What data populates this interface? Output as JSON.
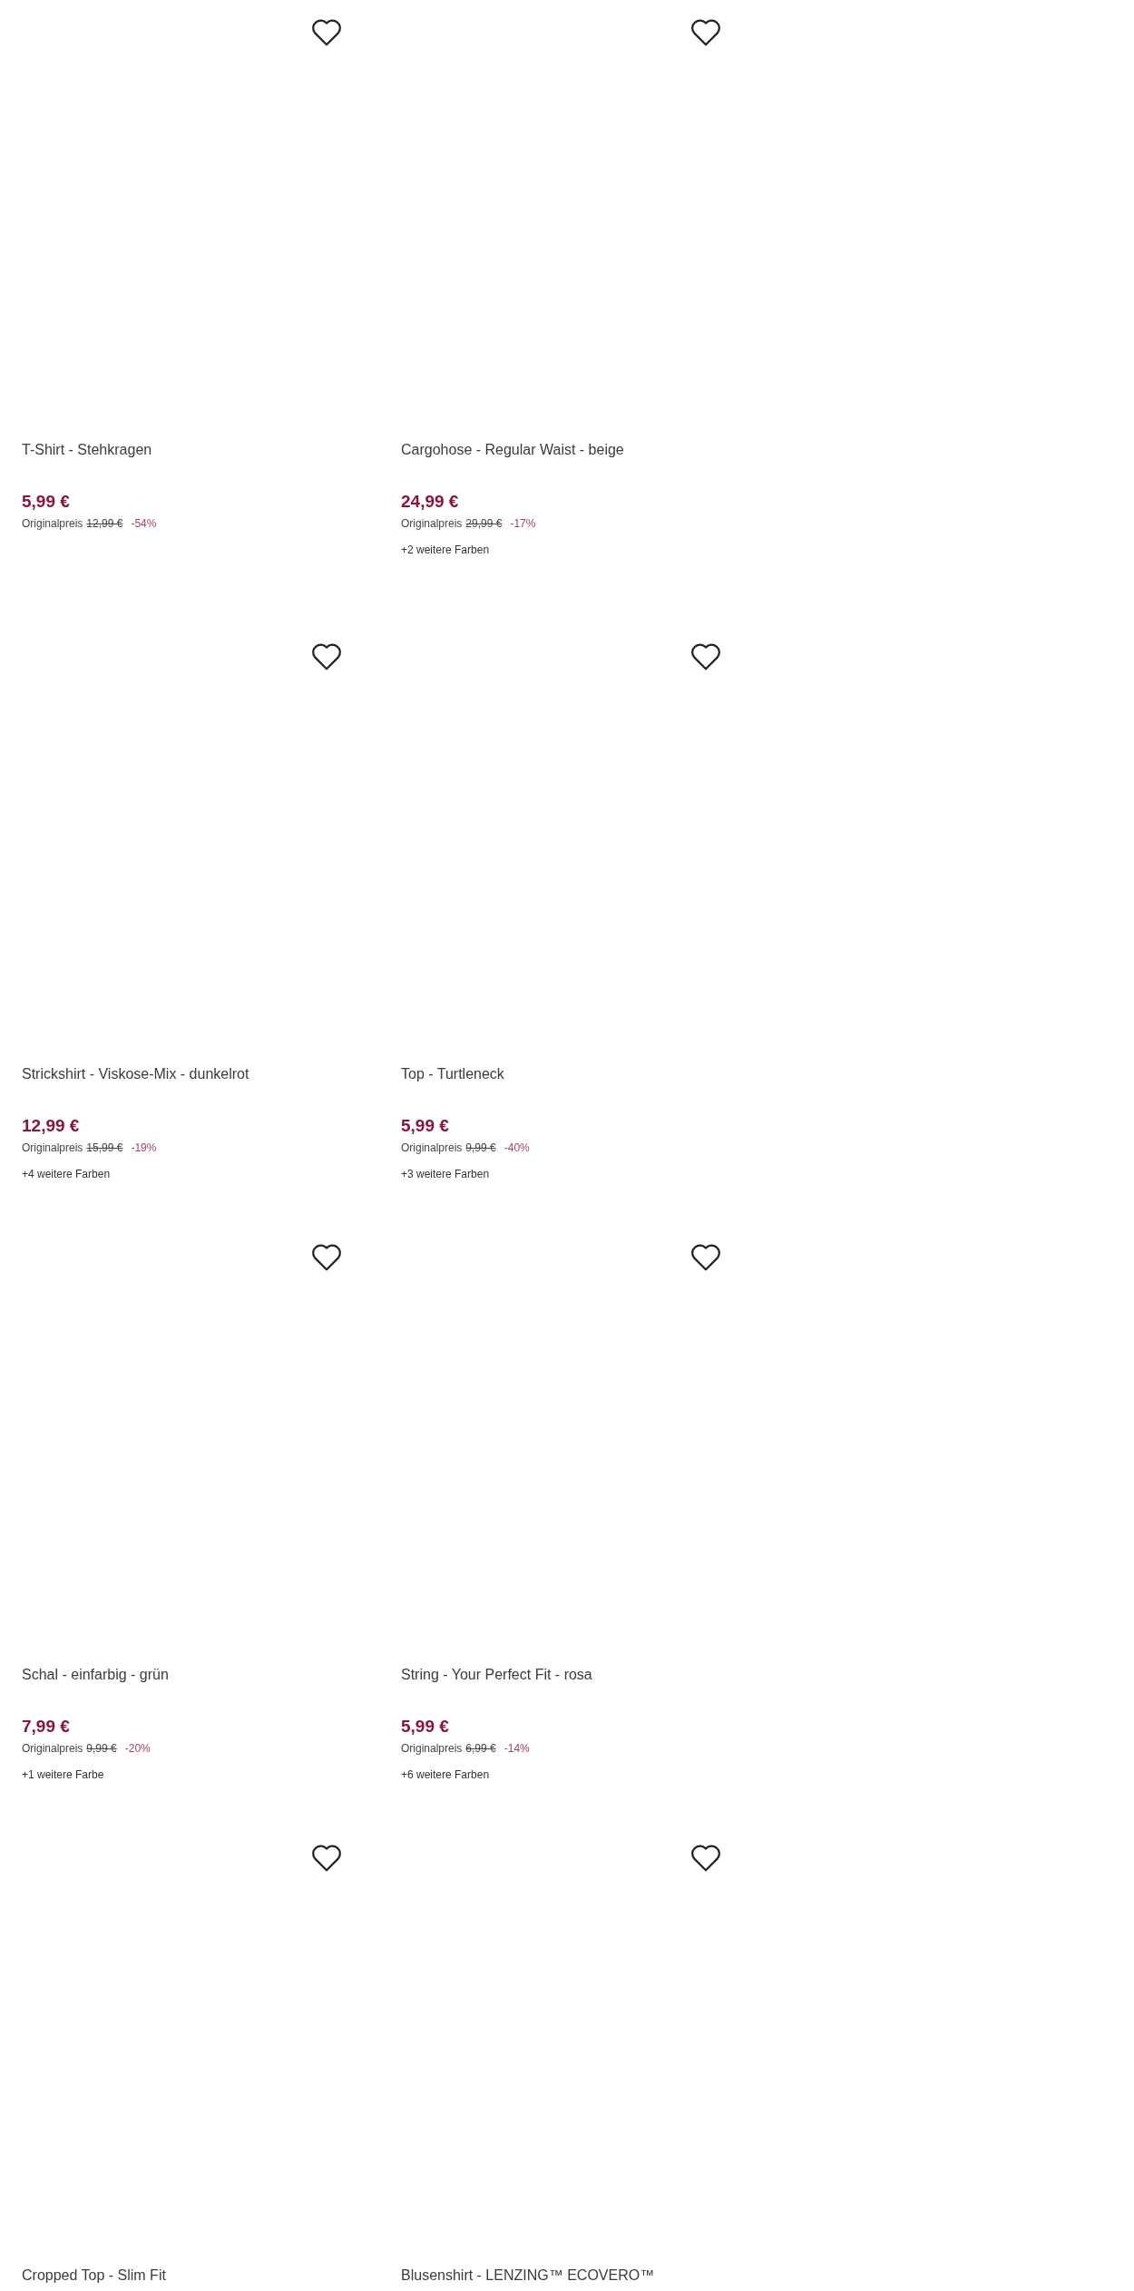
{
  "products": [
    {
      "title": "T-Shirt - Stehkragen",
      "price": "5,99 €",
      "original_label": "Originalpreis",
      "original_price": "12,99 €",
      "discount": "-54%",
      "favorite": false
    },
    {
      "title": "Cargohose - Regular Waist - beige",
      "price": "24,99 €",
      "original_label": "Originalpreis",
      "original_price": "29,99 €",
      "discount": "-17%",
      "more_colors": "+2 weitere Farben",
      "favorite": false
    },
    {
      "title": "Strickshirt - Viskose-Mix - dunkelrot",
      "price": "12,99 €",
      "original_label": "Originalpreis",
      "original_price": "15,99 €",
      "discount": "-19%",
      "more_colors": "+4 weitere Farben",
      "favorite": false
    },
    {
      "title": "Top - Turtleneck",
      "price": "5,99 €",
      "original_label": "Originalpreis",
      "original_price": "9,99 €",
      "discount": "-40%",
      "more_colors": "+3 weitere Farben",
      "favorite": false
    },
    {
      "title": "Schal - einfarbig - grün",
      "price": "7,99 €",
      "original_label": "Originalpreis",
      "original_price": "9,99 €",
      "discount": "-20%",
      "more_colors": "+1 weitere Farbe",
      "favorite": false
    },
    {
      "title": "String - Your Perfect Fit - rosa",
      "price": "5,99 €",
      "original_label": "Originalpreis",
      "original_price": "6,99 €",
      "discount": "-14%",
      "more_colors": "+6 weitere Farben",
      "favorite": false
    },
    {
      "title": "Cropped Top - Slim Fit",
      "favorite": false
    },
    {
      "title": "Blusenshirt - LENZING™ ECOVERO™",
      "favorite": false
    }
  ]
}
